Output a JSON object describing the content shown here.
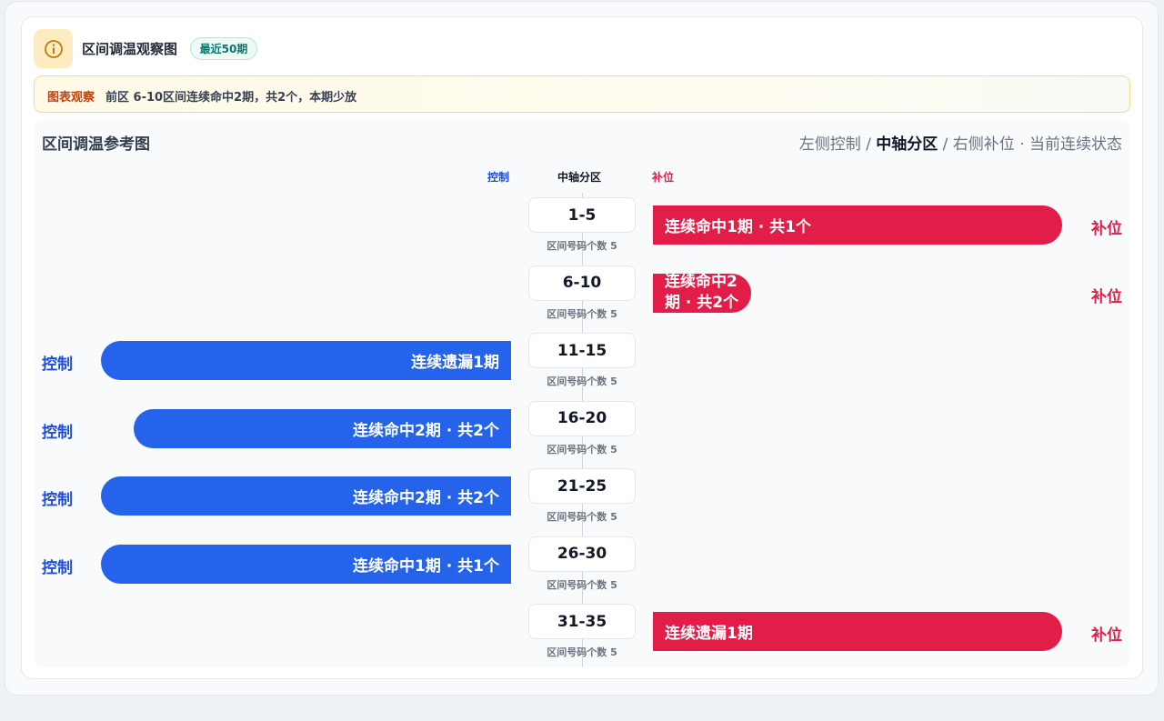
{
  "header": {
    "title": "区间调温观察图",
    "badge": "最近50期",
    "info_icon": "info-circle-icon"
  },
  "observation": {
    "tag": "图表观察",
    "text": "前区 6-10区间连续命中2期，共2个，本期少放"
  },
  "panel": {
    "title": "区间调温参考图",
    "legend_left": "左侧控制 / ",
    "legend_mid": "中轴分区",
    "legend_right": " / 右侧补位 · 当前连续状态"
  },
  "columns": {
    "control": "控制",
    "axis": "中轴分区",
    "fill": "补位"
  },
  "colors": {
    "control": "#2563eb",
    "fill": "#e11d48",
    "badge": "#0f766e"
  },
  "rows": [
    {
      "zone": "1-5",
      "sub": "区间号码个数 5",
      "side": "fill",
      "bar_text": "连续命中1期 · 共1个",
      "side_label": "补位",
      "level": 1.0
    },
    {
      "zone": "6-10",
      "sub": "区间号码个数 5",
      "side": "fill",
      "bar_text": "连续命中2期 · 共2个",
      "side_label": "补位",
      "level": 0.24
    },
    {
      "zone": "11-15",
      "sub": "区间号码个数 5",
      "side": "control",
      "bar_text": "连续遗漏1期",
      "side_label": "控制",
      "level": 1.0
    },
    {
      "zone": "16-20",
      "sub": "区间号码个数 5",
      "side": "control",
      "bar_text": "连续命中2期 · 共2个",
      "side_label": "控制",
      "level": 0.92
    },
    {
      "zone": "21-25",
      "sub": "区间号码个数 5",
      "side": "control",
      "bar_text": "连续命中2期 · 共2个",
      "side_label": "控制",
      "level": 1.0
    },
    {
      "zone": "26-30",
      "sub": "区间号码个数 5",
      "side": "control",
      "bar_text": "连续命中1期 · 共1个",
      "side_label": "控制",
      "level": 1.0
    },
    {
      "zone": "31-35",
      "sub": "区间号码个数 5",
      "side": "fill",
      "bar_text": "连续遗漏1期",
      "side_label": "补位",
      "level": 1.0
    }
  ]
}
